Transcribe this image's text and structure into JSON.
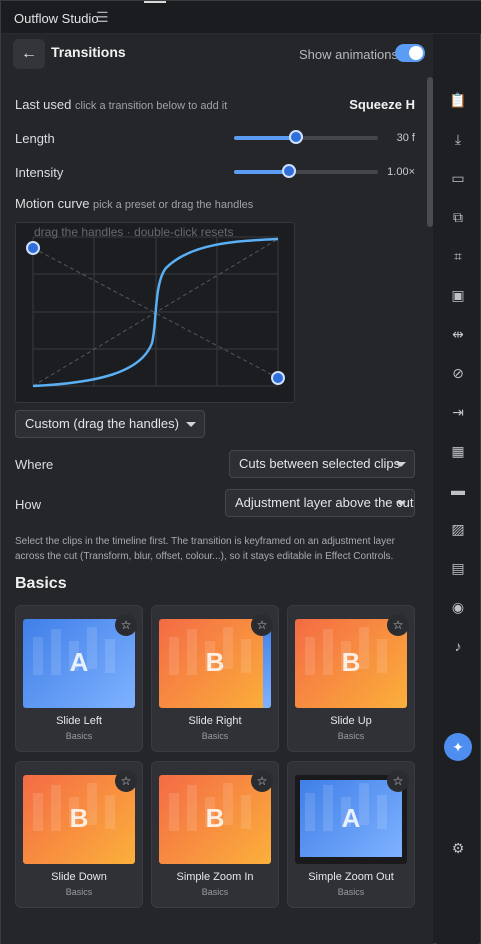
{
  "window": {
    "title": "Outflow Studio",
    "menu_icon": "hamburger-menu-icon"
  },
  "header": {
    "title": "Transitions",
    "show_animations_label": "Show animations",
    "show_animations_on": true,
    "back_icon": "arrow-left-icon"
  },
  "last_used": {
    "label": "Last used",
    "hint": "click a transition below to add it",
    "value": "Squeeze H"
  },
  "length": {
    "label": "Length",
    "value_text": "30 f",
    "level": 0.43
  },
  "intensity": {
    "label": "Intensity",
    "value_text": "1.00×",
    "level": 0.38
  },
  "motion_curve": {
    "label": "Motion curve",
    "hint": "pick a preset or drag the handles",
    "canvas_hint": "drag the handles · double-click resets",
    "preset": "Custom (drag the handles)"
  },
  "where": {
    "label": "Where",
    "value": "Cuts between selected clips"
  },
  "how": {
    "label": "How",
    "value": "Adjustment layer above the cut"
  },
  "description": "Select the clips in the timeline first. The transition is keyframed on an adjustment layer across the cut (Transform, blur, offset, colour...), so it stays editable in Effect Controls.",
  "section": {
    "title": "Basics"
  },
  "cards": [
    {
      "name": "Slide Left",
      "category": "Basics",
      "letter": "A",
      "style": "blue"
    },
    {
      "name": "Slide Right",
      "category": "Basics",
      "letter": "B",
      "style": "orange"
    },
    {
      "name": "Slide Up",
      "category": "Basics",
      "letter": "B",
      "style": "orange"
    },
    {
      "name": "Slide Down",
      "category": "Basics",
      "letter": "B",
      "style": "orange"
    },
    {
      "name": "Simple Zoom In",
      "category": "Basics",
      "letter": "B",
      "style": "orange"
    },
    {
      "name": "Simple Zoom Out",
      "category": "Basics",
      "letter": "A",
      "style": "blue"
    }
  ],
  "sidebar_icons": [
    "clipboard-icon",
    "download-icon",
    "subtitles-icon",
    "layers-icon",
    "crop-icon",
    "frame-icon",
    "split-icon",
    "disabled-icon",
    "transition-icon",
    "grid-icon",
    "divider-icon",
    "image-icon",
    "document-icon",
    "camera-icon",
    "audio-icon"
  ],
  "colors": {
    "accent": "#5b9cf4",
    "panel": "#25262a",
    "card": "#303136"
  }
}
